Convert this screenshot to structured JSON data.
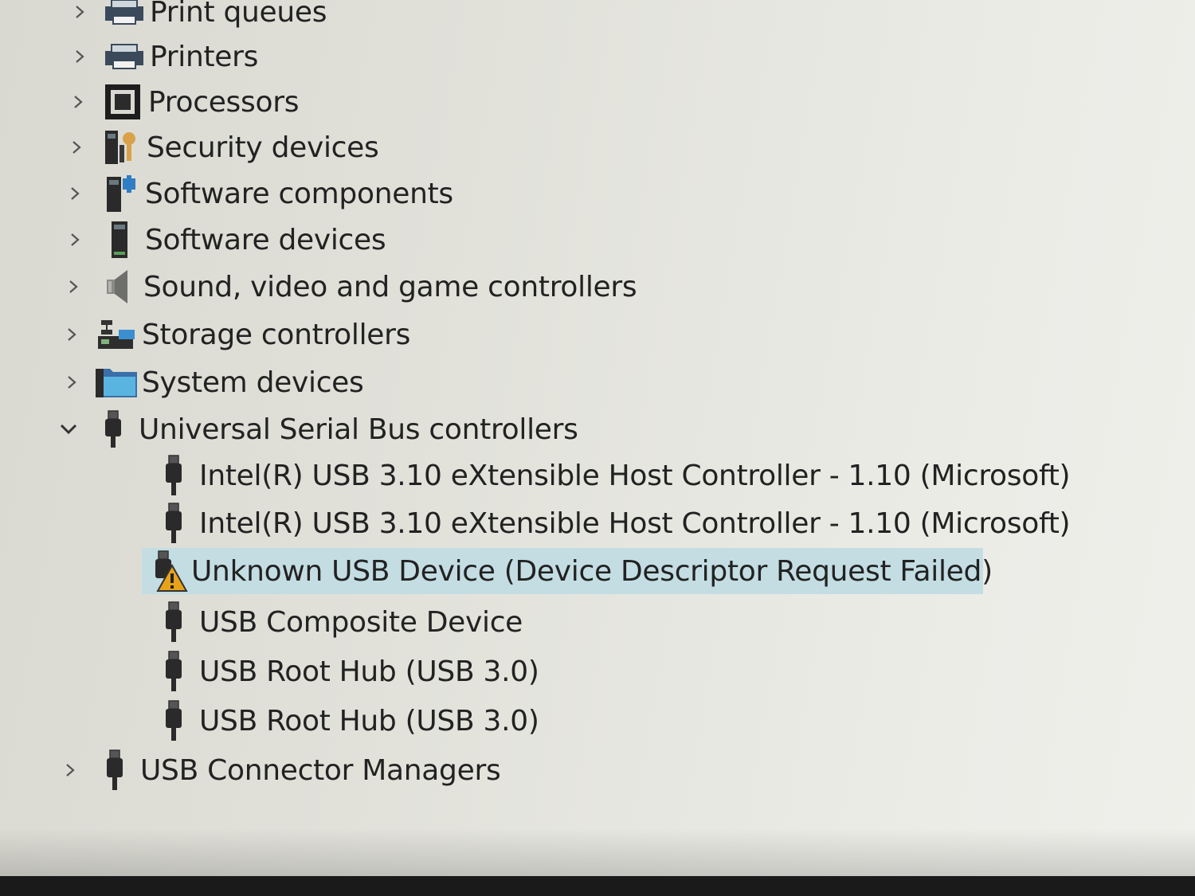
{
  "tree": {
    "categories_top": [
      {
        "label": "Print queues",
        "icon": "printer-icon",
        "expanded": false
      },
      {
        "label": "Printers",
        "icon": "printer-icon",
        "expanded": false
      },
      {
        "label": "Processors",
        "icon": "processor-icon",
        "expanded": false
      },
      {
        "label": "Security devices",
        "icon": "security-device-icon",
        "expanded": false
      },
      {
        "label": "Software components",
        "icon": "software-component-icon",
        "expanded": false
      },
      {
        "label": "Software devices",
        "icon": "software-device-icon",
        "expanded": false
      },
      {
        "label": "Sound, video and game controllers",
        "icon": "speaker-icon",
        "expanded": false
      },
      {
        "label": "Storage controllers",
        "icon": "storage-controller-icon",
        "expanded": false
      },
      {
        "label": "System devices",
        "icon": "system-folder-icon",
        "expanded": false
      },
      {
        "label": "Universal Serial Bus controllers",
        "icon": "usb-plug-icon",
        "expanded": true
      }
    ],
    "usb_children": [
      {
        "label": "Intel(R) USB 3.10 eXtensible Host Controller - 1.10 (Microsoft)",
        "icon": "usb-plug-icon"
      },
      {
        "label": "Intel(R) USB 3.10 eXtensible Host Controller - 1.10 (Microsoft)",
        "icon": "usb-plug-icon"
      },
      {
        "label": "Unknown USB Device (Device Descriptor Request Failed)",
        "icon": "usb-warning-icon",
        "selected": true
      },
      {
        "label": "USB Composite Device",
        "icon": "usb-plug-icon"
      },
      {
        "label": "USB Root Hub (USB 3.0)",
        "icon": "usb-plug-icon"
      },
      {
        "label": "USB Root Hub (USB 3.0)",
        "icon": "usb-plug-icon"
      }
    ],
    "categories_bottom": [
      {
        "label": "USB Connector Managers",
        "icon": "usb-plug-icon",
        "expanded": false
      }
    ]
  },
  "colors": {
    "selection": "#c3dde3",
    "warning": "#e8a21a",
    "text": "#222222"
  }
}
